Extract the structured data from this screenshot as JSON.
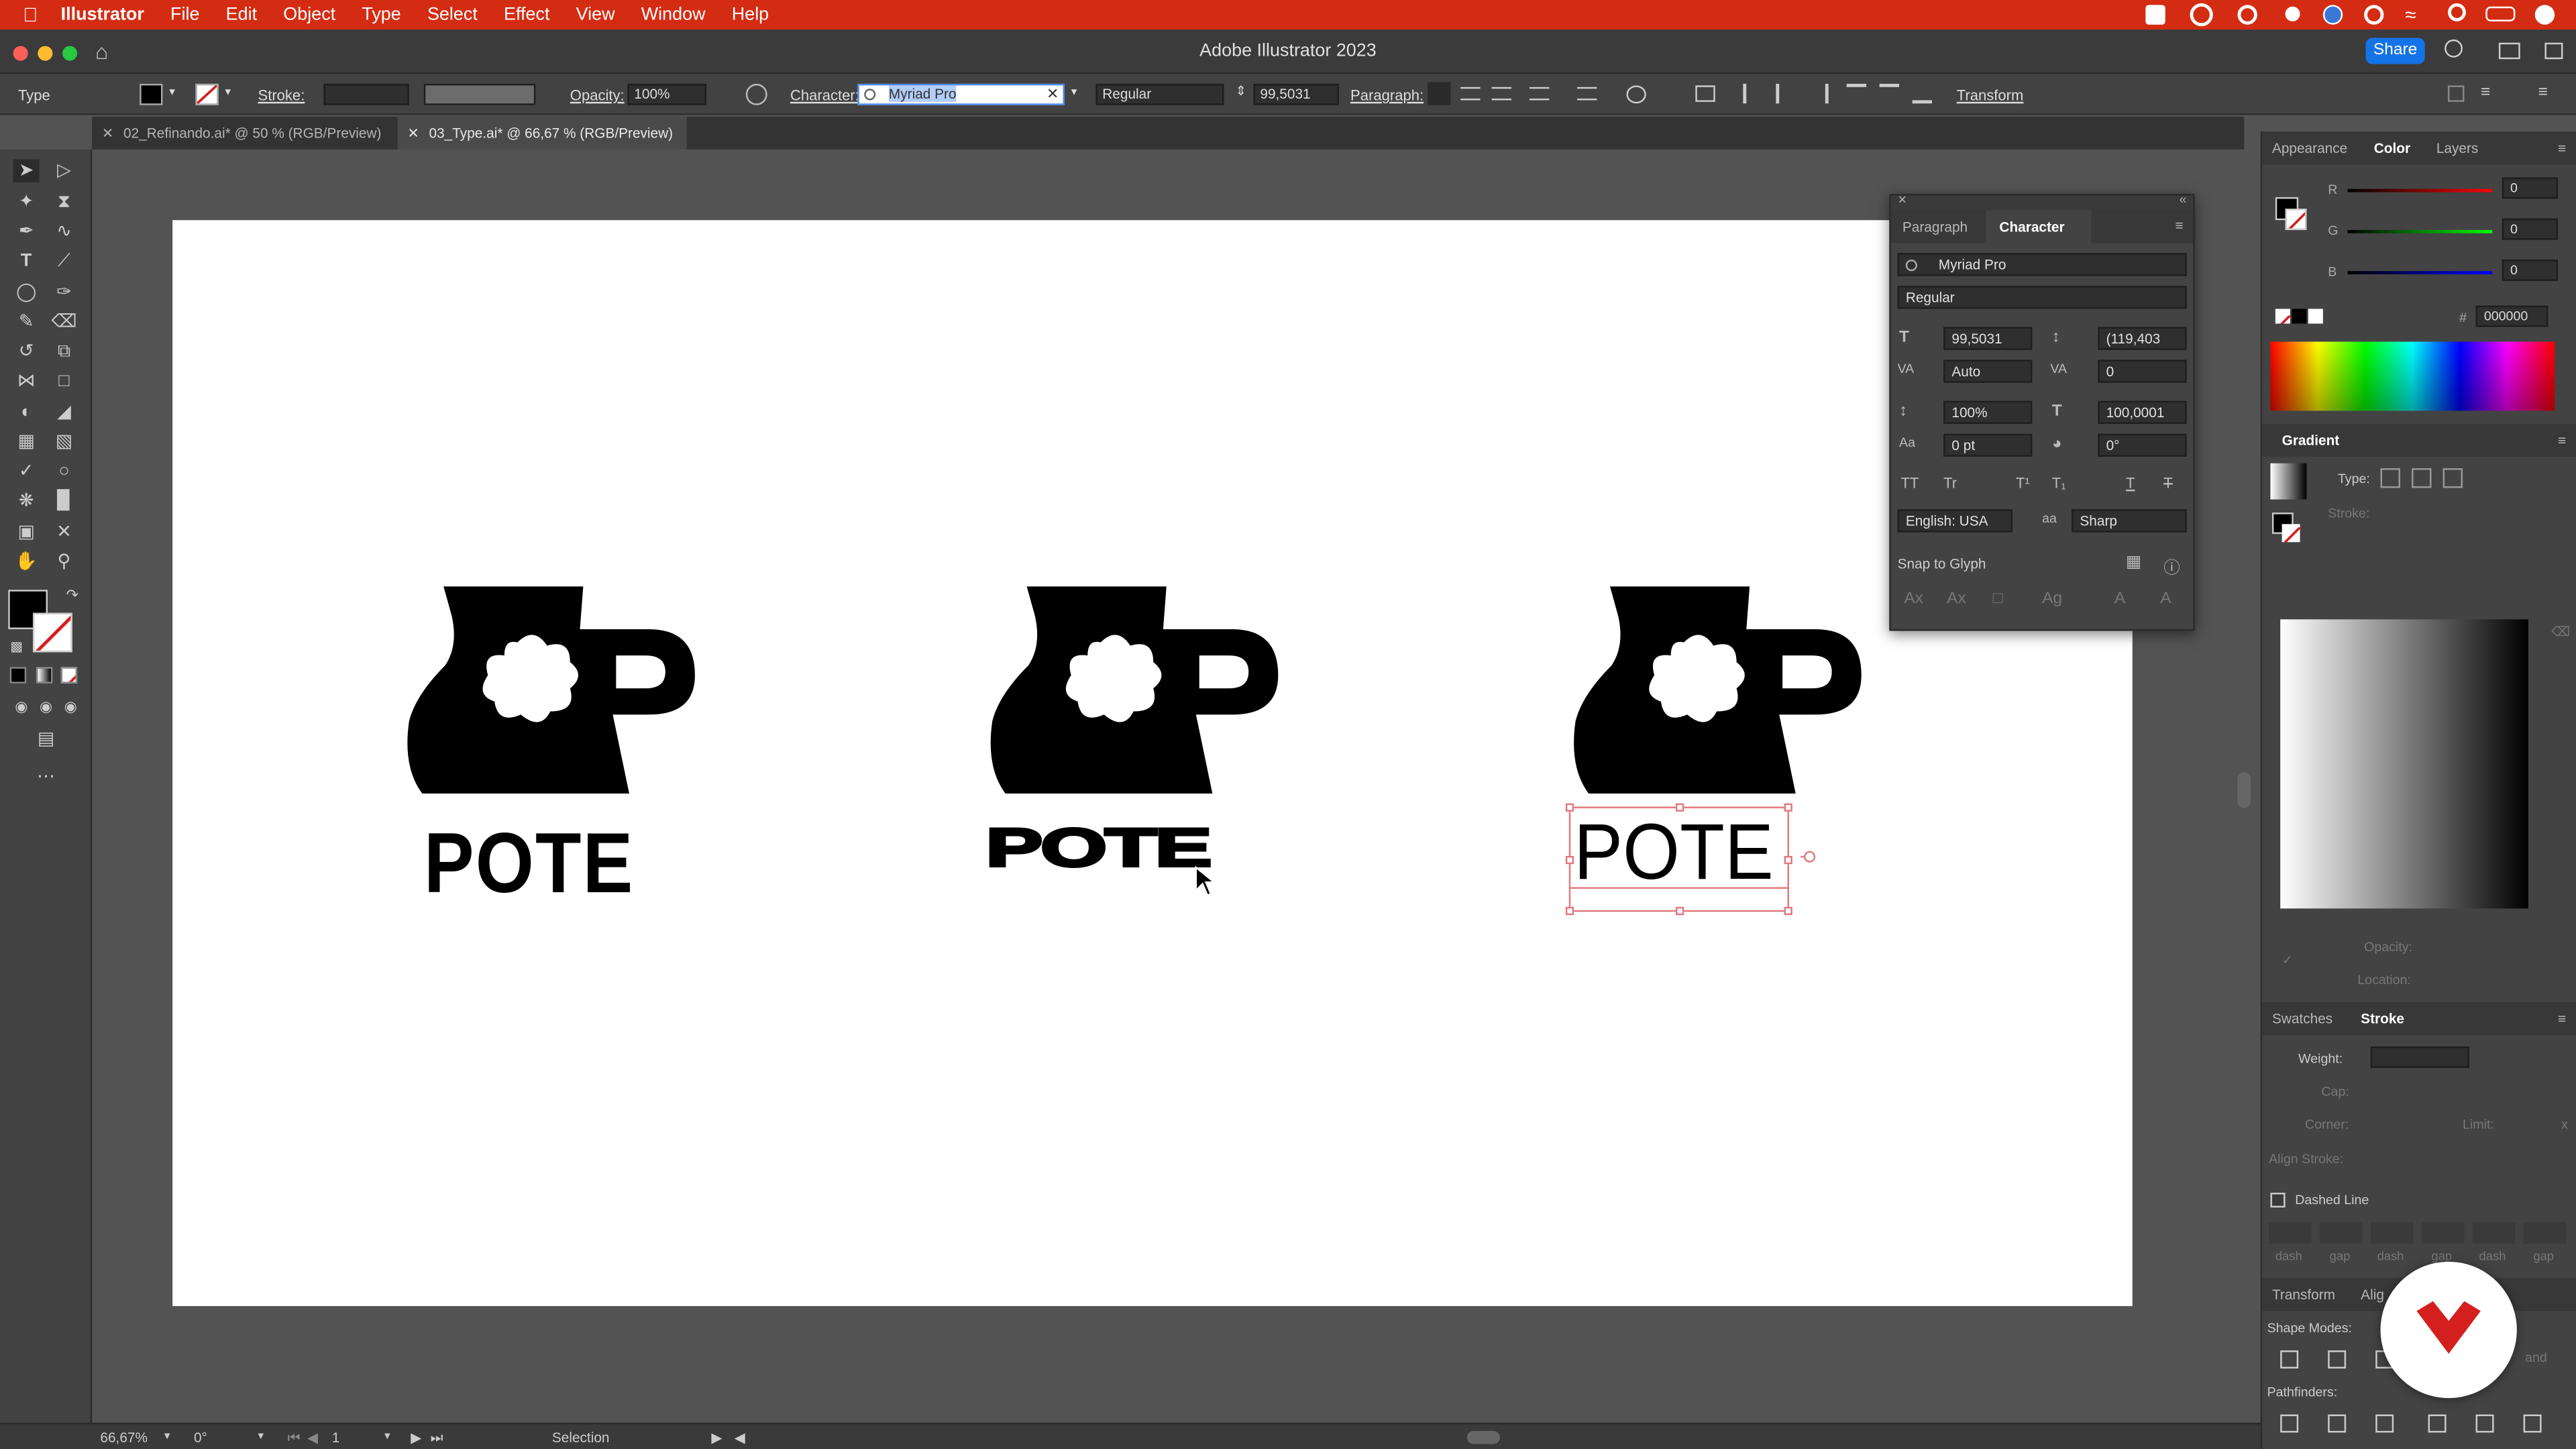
{
  "menubar": {
    "app": "Illustrator",
    "items": [
      "File",
      "Edit",
      "Object",
      "Type",
      "Select",
      "Effect",
      "View",
      "Window",
      "Help"
    ]
  },
  "window": {
    "title": "Adobe Illustrator 2023",
    "share_label": "Share"
  },
  "control": {
    "tool_label": "Type",
    "stroke_label": "Stroke:",
    "opacity_label": "Opacity:",
    "opacity_value": "100%",
    "character_label": "Character:",
    "font_value": "Myriad Pro",
    "style_value": "Regular",
    "size_value": "99,5031",
    "paragraph_label": "Paragraph:",
    "transform_label": "Transform"
  },
  "tabs": [
    {
      "label": "02_Refinando.ai* @ 50 % (RGB/Preview)"
    },
    {
      "label": "03_Type.ai* @ 66,67 % (RGB/Preview)"
    }
  ],
  "artwork": {
    "word": "POTE"
  },
  "status": {
    "zoom": "66,67%",
    "rotation": "0°",
    "page": "1",
    "tool": "Selection"
  },
  "char_panel": {
    "tab_paragraph": "Paragraph",
    "tab_character": "Character",
    "font": "Myriad Pro",
    "style": "Regular",
    "size": "99,5031",
    "leading": "(119,403",
    "kerning": "Auto",
    "tracking": "0",
    "vscale": "100%",
    "hscale": "100,0001",
    "baseline": "0 pt",
    "rotation": "0°",
    "language": "English: USA",
    "antialias": "Sharp",
    "snap": "Snap to Glyph"
  },
  "right": {
    "tabs": [
      "Appearance",
      "Color",
      "Layers"
    ],
    "r": "0",
    "g": "0",
    "b": "0",
    "r_label": "R",
    "g_label": "G",
    "b_label": "B",
    "hex_prefix": "#",
    "hex": "000000",
    "gradient_title": "Gradient",
    "type_label": "Type:",
    "stroke_label": "Stroke:",
    "opacity_label": "Opacity:",
    "location_label": "Location:",
    "swatches_tab": "Swatches",
    "stroke_tab": "Stroke",
    "weight_label": "Weight:",
    "cap_label": "Cap:",
    "corner_label": "Corner:",
    "limit_label": "Limit:",
    "limit_unit": "x",
    "align_label": "Align Stroke:",
    "dashed_label": "Dashed Line",
    "dash_labels": [
      "dash",
      "gap",
      "dash",
      "gap",
      "dash",
      "gap"
    ],
    "transform_tab": "Transform",
    "align_tab": "Alig",
    "shape_modes": "Shape Modes:",
    "pathfinders": "Pathfinders:",
    "expand_partial": "and"
  },
  "colors": {
    "menubar": "#d42c13",
    "accent": "#1473e6",
    "badge": "#d3201f"
  }
}
